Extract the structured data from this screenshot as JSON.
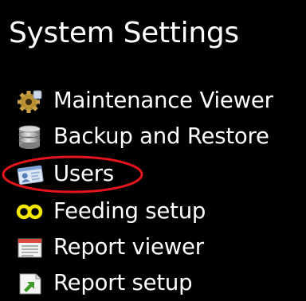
{
  "panel": {
    "title": "System Settings",
    "items": [
      {
        "label": "Maintenance Viewer",
        "icon": "gear-icon"
      },
      {
        "label": "Backup and Restore",
        "icon": "database-icon"
      },
      {
        "label": "Users",
        "icon": "user-card-icon"
      },
      {
        "label": "Feeding setup",
        "icon": "feeding-icon"
      },
      {
        "label": "Report viewer",
        "icon": "report-viewer-icon"
      },
      {
        "label": "Report setup",
        "icon": "report-setup-icon"
      }
    ]
  },
  "annotation": {
    "highlighted_item": "Users",
    "color": "#e3141c"
  },
  "colors": {
    "background": "#000000",
    "text": "#ffffff",
    "feeding_icon": "#f2e600",
    "report_setup_icon": "#3f9a2c"
  }
}
